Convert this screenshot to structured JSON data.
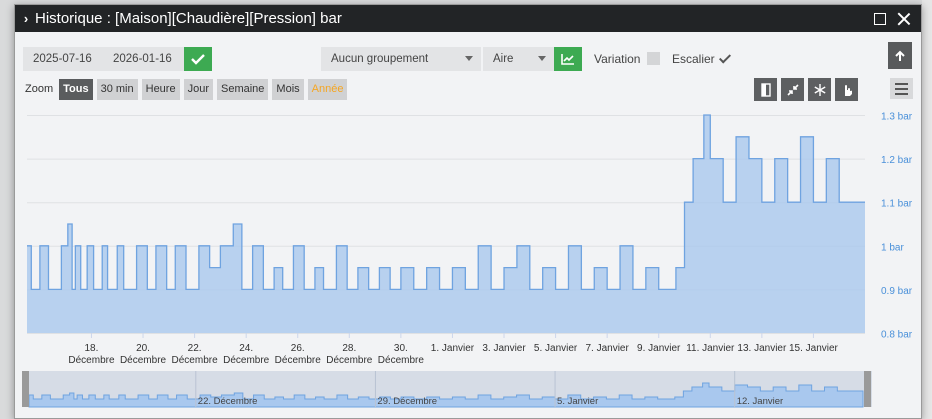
{
  "window": {
    "title": "Historique : [Maison][Chaudière][Pression] bar"
  },
  "toolbar": {
    "date_start": "2025-07-16",
    "date_end": "2026-01-16",
    "grouping": "Aucun groupement",
    "chart_kind": "Aire",
    "variation_label": "Variation",
    "escalier_label": "Escalier",
    "variation_checked": false,
    "escalier_checked": true
  },
  "zoom": {
    "label": "Zoom",
    "buttons": [
      "Tous",
      "30 min",
      "Heure",
      "Jour",
      "Semaine",
      "Mois",
      "Année"
    ],
    "active": "Tous"
  },
  "icons": {
    "confirm": "check-icon",
    "chart_type": "line-chart-icon",
    "scroll_up": "arrow-up-icon",
    "menu": "hamburger-icon",
    "tools": [
      "column-icon",
      "compress-icon",
      "snowflake-icon",
      "hand-pointer-icon"
    ]
  },
  "colors": {
    "series": "#6fa3e0",
    "area": "#a9c8ee",
    "check_green": "#3daa52",
    "axis_text": "#4a90d9"
  },
  "chart_data": {
    "type": "area",
    "step": true,
    "title": "",
    "xlabel": "",
    "ylabel": "",
    "ylim": [
      0.8,
      1.3
    ],
    "y_ticks": [
      "0.8 bar",
      "0.9 bar",
      "1 bar",
      "1.1 bar",
      "1.2 bar",
      "1.3 bar"
    ],
    "y_tick_values": [
      0.8,
      0.9,
      1.0,
      1.1,
      1.2,
      1.3
    ],
    "x_range": [
      "2025-12-15T12:00",
      "2026-01-17T00:00"
    ],
    "x_ticks": [
      {
        "date": "2025-12-18",
        "line1": "18.",
        "line2": "Décembre"
      },
      {
        "date": "2025-12-20",
        "line1": "20.",
        "line2": "Décembre"
      },
      {
        "date": "2025-12-22",
        "line1": "22.",
        "line2": "Décembre"
      },
      {
        "date": "2025-12-24",
        "line1": "24.",
        "line2": "Décembre"
      },
      {
        "date": "2025-12-26",
        "line1": "26.",
        "line2": "Décembre"
      },
      {
        "date": "2025-12-28",
        "line1": "28.",
        "line2": "Décembre"
      },
      {
        "date": "2025-12-30",
        "line1": "30.",
        "line2": "Décembre"
      },
      {
        "date": "2026-01-01",
        "line1": "1. Janvier",
        "line2": ""
      },
      {
        "date": "2026-01-03",
        "line1": "3. Janvier",
        "line2": ""
      },
      {
        "date": "2026-01-05",
        "line1": "5. Janvier",
        "line2": ""
      },
      {
        "date": "2026-01-07",
        "line1": "7. Janvier",
        "line2": ""
      },
      {
        "date": "2026-01-09",
        "line1": "9. Janvier",
        "line2": ""
      },
      {
        "date": "2026-01-11",
        "line1": "11. Janvier",
        "line2": ""
      },
      {
        "date": "2026-01-13",
        "line1": "13. Janvier",
        "line2": ""
      },
      {
        "date": "2026-01-15",
        "line1": "15. Janvier",
        "line2": ""
      }
    ],
    "navigator_ticks": [
      {
        "date": "2025-12-22",
        "label": "22. Décembre"
      },
      {
        "date": "2025-12-29",
        "label": "29. Décembre"
      },
      {
        "date": "2026-01-05",
        "label": "5. Janvier"
      },
      {
        "date": "2026-01-12",
        "label": "12. Janvier"
      }
    ],
    "series": [
      {
        "name": "",
        "points": [
          [
            "2025-12-15T12:00",
            1.0
          ],
          [
            "2025-12-15T16:00",
            0.9
          ],
          [
            "2025-12-16T00:00",
            1.0
          ],
          [
            "2025-12-16T08:00",
            0.9
          ],
          [
            "2025-12-16T20:00",
            1.0
          ],
          [
            "2025-12-17T02:00",
            1.05
          ],
          [
            "2025-12-17T06:00",
            0.9
          ],
          [
            "2025-12-17T09:00",
            1.0
          ],
          [
            "2025-12-17T14:00",
            0.9
          ],
          [
            "2025-12-17T20:00",
            1.0
          ],
          [
            "2025-12-18T02:00",
            0.9
          ],
          [
            "2025-12-18T10:00",
            1.0
          ],
          [
            "2025-12-18T15:00",
            0.9
          ],
          [
            "2025-12-19T00:00",
            1.0
          ],
          [
            "2025-12-19T06:00",
            0.9
          ],
          [
            "2025-12-19T18:00",
            1.0
          ],
          [
            "2025-12-20T04:00",
            0.9
          ],
          [
            "2025-12-20T12:00",
            1.0
          ],
          [
            "2025-12-20T22:00",
            0.9
          ],
          [
            "2025-12-21T06:00",
            1.0
          ],
          [
            "2025-12-21T16:00",
            0.9
          ],
          [
            "2025-12-22T04:00",
            1.0
          ],
          [
            "2025-12-22T14:00",
            0.95
          ],
          [
            "2025-12-23T00:00",
            1.0
          ],
          [
            "2025-12-23T12:00",
            1.05
          ],
          [
            "2025-12-23T20:00",
            0.9
          ],
          [
            "2025-12-24T06:00",
            1.0
          ],
          [
            "2025-12-24T16:00",
            0.9
          ],
          [
            "2025-12-25T02:00",
            0.95
          ],
          [
            "2025-12-25T10:00",
            0.9
          ],
          [
            "2025-12-25T20:00",
            1.0
          ],
          [
            "2025-12-26T06:00",
            0.9
          ],
          [
            "2025-12-26T16:00",
            0.95
          ],
          [
            "2025-12-27T00:00",
            0.9
          ],
          [
            "2025-12-27T12:00",
            1.0
          ],
          [
            "2025-12-27T22:00",
            0.9
          ],
          [
            "2025-12-28T08:00",
            0.95
          ],
          [
            "2025-12-28T18:00",
            0.9
          ],
          [
            "2025-12-29T04:00",
            0.95
          ],
          [
            "2025-12-29T14:00",
            0.9
          ],
          [
            "2025-12-30T00:00",
            0.95
          ],
          [
            "2025-12-30T12:00",
            0.9
          ],
          [
            "2025-12-31T00:00",
            0.95
          ],
          [
            "2025-12-31T12:00",
            0.9
          ],
          [
            "2026-01-01T00:00",
            0.95
          ],
          [
            "2026-01-01T12:00",
            0.9
          ],
          [
            "2026-01-02T00:00",
            1.0
          ],
          [
            "2026-01-02T12:00",
            0.9
          ],
          [
            "2026-01-03T00:00",
            0.95
          ],
          [
            "2026-01-03T12:00",
            1.0
          ],
          [
            "2026-01-04T00:00",
            0.9
          ],
          [
            "2026-01-04T12:00",
            0.95
          ],
          [
            "2026-01-05T00:00",
            0.9
          ],
          [
            "2026-01-05T12:00",
            1.0
          ],
          [
            "2026-01-06T00:00",
            0.9
          ],
          [
            "2026-01-06T12:00",
            0.95
          ],
          [
            "2026-01-07T00:00",
            0.9
          ],
          [
            "2026-01-07T12:00",
            1.0
          ],
          [
            "2026-01-08T00:00",
            0.9
          ],
          [
            "2026-01-08T12:00",
            0.95
          ],
          [
            "2026-01-09T00:00",
            0.9
          ],
          [
            "2026-01-09T16:00",
            0.95
          ],
          [
            "2026-01-10T00:00",
            1.1
          ],
          [
            "2026-01-10T08:00",
            1.2
          ],
          [
            "2026-01-10T18:00",
            1.3
          ],
          [
            "2026-01-11T00:00",
            1.2
          ],
          [
            "2026-01-11T12:00",
            1.1
          ],
          [
            "2026-01-12T00:00",
            1.25
          ],
          [
            "2026-01-12T12:00",
            1.2
          ],
          [
            "2026-01-13T00:00",
            1.1
          ],
          [
            "2026-01-13T12:00",
            1.2
          ],
          [
            "2026-01-14T00:00",
            1.1
          ],
          [
            "2026-01-14T12:00",
            1.25
          ],
          [
            "2026-01-15T00:00",
            1.1
          ],
          [
            "2026-01-15T12:00",
            1.2
          ],
          [
            "2026-01-16T00:00",
            1.1
          ],
          [
            "2026-01-16T12:00",
            1.1
          ]
        ]
      }
    ]
  }
}
